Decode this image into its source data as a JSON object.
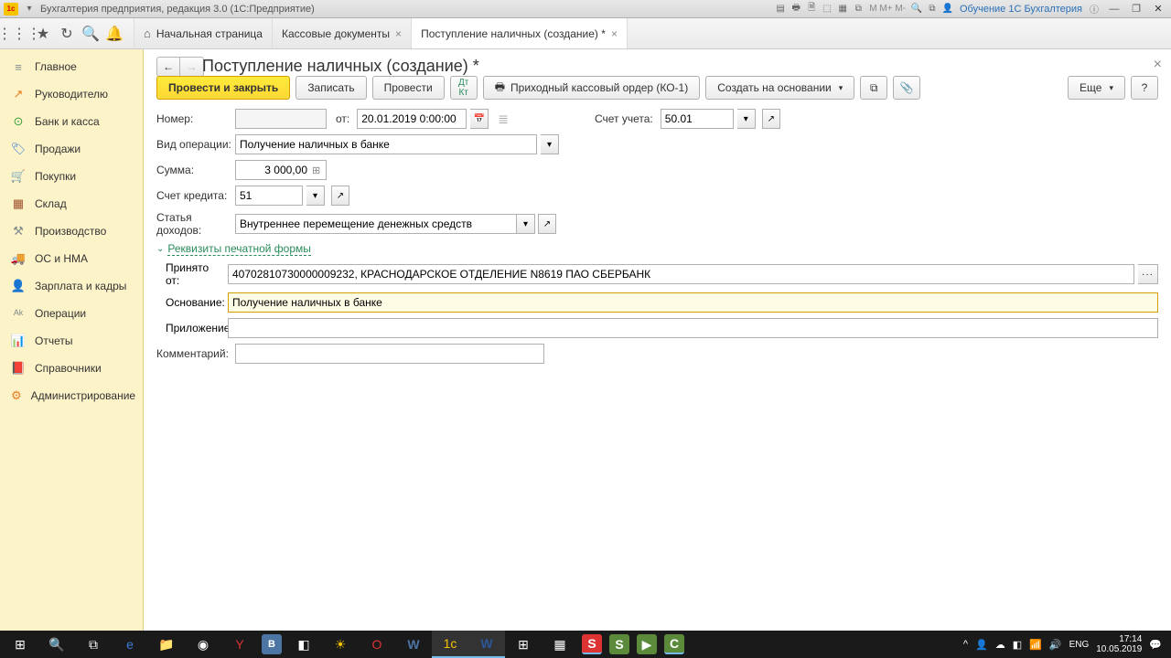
{
  "titlebar": {
    "title": "Бухгалтерия предприятия, редакция 3.0 (1С:Предприятие)",
    "m_labels": "M M+ M-",
    "user": "Обучение 1С Бухгалтерия"
  },
  "tabs": {
    "home": "Начальная страница",
    "tab1": "Кассовые документы",
    "tab2": "Поступление наличных (создание) *"
  },
  "sidebar": {
    "items": [
      {
        "label": "Главное",
        "icon": "≡",
        "cls": "icon-color-gray"
      },
      {
        "label": "Руководителю",
        "icon": "↗",
        "cls": "icon-color-orange"
      },
      {
        "label": "Банк и касса",
        "icon": "⊙",
        "cls": "icon-color-green"
      },
      {
        "label": "Продажи",
        "icon": "🏷",
        "cls": "icon-color-blue"
      },
      {
        "label": "Покупки",
        "icon": "🛒",
        "cls": "icon-color-teal"
      },
      {
        "label": "Склад",
        "icon": "▦",
        "cls": "icon-color-brown"
      },
      {
        "label": "Производство",
        "icon": "⚒",
        "cls": "icon-color-gray"
      },
      {
        "label": "ОС и НМА",
        "icon": "🚚",
        "cls": "icon-color-orange"
      },
      {
        "label": "Зарплата и кадры",
        "icon": "👤",
        "cls": "icon-color-blue"
      },
      {
        "label": "Операции",
        "icon": "ᴬᵏ",
        "cls": "icon-color-gray"
      },
      {
        "label": "Отчеты",
        "icon": "📊",
        "cls": "icon-color-blue"
      },
      {
        "label": "Справочники",
        "icon": "📕",
        "cls": "icon-color-orange"
      },
      {
        "label": "Администрирование",
        "icon": "⚙",
        "cls": "icon-color-orange"
      }
    ]
  },
  "page": {
    "title": "Поступление наличных (создание) *",
    "buttons": {
      "submit_close": "Провести и закрыть",
      "save": "Записать",
      "submit": "Провести",
      "print": "Приходный кассовый ордер (КО-1)",
      "create_based": "Создать на основании",
      "more": "Еще"
    },
    "labels": {
      "number": "Номер:",
      "from": "от:",
      "account": "Счет учета:",
      "op_type": "Вид операции:",
      "amount": "Сумма:",
      "credit_acc": "Счет кредита:",
      "income_item": "Статья доходов:",
      "print_section": "Реквизиты печатной формы",
      "received_from": "Принято от:",
      "basis": "Основание:",
      "attachment": "Приложение:",
      "comment": "Комментарий:"
    },
    "values": {
      "number": "",
      "date": "20.01.2019 0:00:00",
      "account": "50.01",
      "op_type": "Получение наличных в банке",
      "amount": "3 000,00",
      "credit_acc": "51",
      "income_item": "Внутреннее перемещение денежных средств",
      "received_from": "40702810730000009232, КРАСНОДАРСКОЕ ОТДЕЛЕНИЕ N8619 ПАО СБЕРБАНК",
      "basis": "Получение наличных в банке",
      "attachment": "",
      "comment": ""
    }
  },
  "taskbar": {
    "lang": "ENG",
    "time": "17:14",
    "date": "10.05.2019"
  }
}
